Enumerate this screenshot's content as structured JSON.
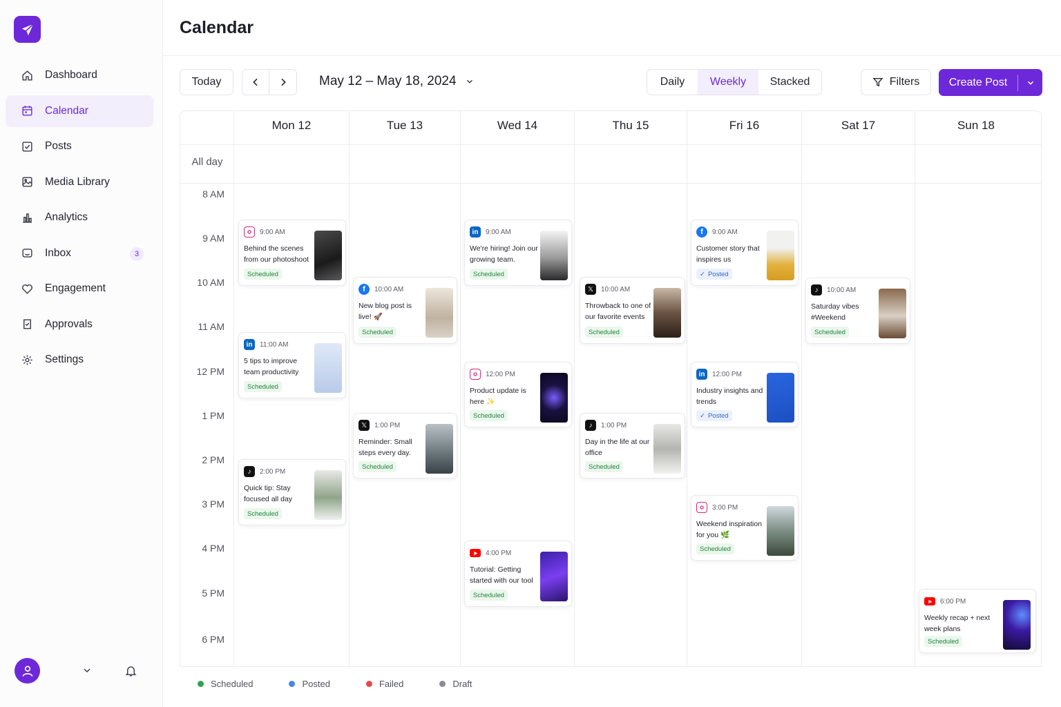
{
  "app": {
    "title": "Calendar"
  },
  "colors": {
    "accent": "#6d28d9",
    "scheduled": "#2da44e",
    "posted": "#4a86e8",
    "failed": "#e5484d",
    "draft": "#8a8a94"
  },
  "sidebar": {
    "logo_icon": "paper-plane-icon",
    "items": [
      {
        "label": "Dashboard",
        "icon": "home-icon"
      },
      {
        "label": "Calendar",
        "icon": "calendar-icon",
        "active": true
      },
      {
        "label": "Posts",
        "icon": "posts-icon"
      },
      {
        "label": "Media Library",
        "icon": "image-icon"
      },
      {
        "label": "Analytics",
        "icon": "bar-chart-icon"
      },
      {
        "label": "Inbox",
        "icon": "inbox-icon",
        "badge": "3"
      },
      {
        "label": "Engagement",
        "icon": "heart-icon"
      },
      {
        "label": "Approvals",
        "icon": "approval-icon"
      },
      {
        "label": "Settings",
        "icon": "gear-icon"
      }
    ]
  },
  "toolbar": {
    "today": "Today",
    "date_range": "May 12 – May 18, 2024",
    "views": [
      "Daily",
      "Weekly",
      "Stacked"
    ],
    "active_view": "Weekly",
    "filters": "Filters",
    "create": "Create Post"
  },
  "calendar": {
    "days": [
      "Mon 12",
      "Tue 13",
      "Wed 14",
      "Thu 15",
      "Fri 16",
      "Sat 17",
      "Sun 18"
    ],
    "all_day": "All day",
    "times": [
      "8 AM",
      "9 AM",
      "10 AM",
      "11 AM",
      "12 PM",
      "1 PM",
      "2 PM",
      "3 PM",
      "4 PM",
      "5 PM",
      "6 PM"
    ]
  },
  "events": [
    {
      "day": "Mon 12",
      "network": "instagram",
      "time": "9:00 AM",
      "text": "Behind the scenes from our photoshoot",
      "status": "Scheduled"
    },
    {
      "day": "Mon 12",
      "network": "linkedin",
      "time": "11:00 AM",
      "text": "5 tips to improve team productivity",
      "status": "Scheduled"
    },
    {
      "day": "Mon 12",
      "network": "tiktok",
      "time": "2:00 PM",
      "text": "Quick tip: Stay focused all day",
      "status": "Scheduled"
    },
    {
      "day": "Tue 13",
      "network": "facebook",
      "time": "10:00 AM",
      "text": "New blog post is live! 🚀",
      "status": "Scheduled"
    },
    {
      "day": "Tue 13",
      "network": "x",
      "time": "1:00 PM",
      "text": "Reminder: Small steps every day.",
      "status": "Scheduled"
    },
    {
      "day": "Wed 14",
      "network": "linkedin",
      "time": "9:00 AM",
      "text": "We're hiring! Join our growing team.",
      "status": "Scheduled"
    },
    {
      "day": "Wed 14",
      "network": "instagram",
      "time": "12:00 PM",
      "text": "Product update is here ✨",
      "status": "Scheduled"
    },
    {
      "day": "Wed 14",
      "network": "youtube",
      "time": "4:00 PM",
      "text": "Tutorial: Getting started with our tool",
      "status": "Scheduled"
    },
    {
      "day": "Thu 15",
      "network": "x",
      "time": "10:00 AM",
      "text": "Throwback to one of our favorite events",
      "status": "Scheduled"
    },
    {
      "day": "Thu 15",
      "network": "tiktok",
      "time": "1:00 PM",
      "text": "Day in the life at our office",
      "status": "Scheduled"
    },
    {
      "day": "Fri 16",
      "network": "facebook",
      "time": "9:00 AM",
      "text": "Customer story that inspires us",
      "status": "Posted"
    },
    {
      "day": "Fri 16",
      "network": "linkedin",
      "time": "12:00 PM",
      "text": "Industry insights and trends",
      "status": "Posted"
    },
    {
      "day": "Fri 16",
      "network": "instagram",
      "time": "3:00 PM",
      "text": "Weekend inspiration for you 🌿",
      "status": "Scheduled"
    },
    {
      "day": "Sat 17",
      "network": "tiktok",
      "time": "10:00 AM",
      "text": "Saturday vibes #Weekend",
      "status": "Scheduled"
    },
    {
      "day": "Sun 18",
      "network": "youtube",
      "time": "6:00 PM",
      "text": "Weekly recap + next week plans",
      "status": "Scheduled"
    }
  ],
  "legend": [
    {
      "label": "Scheduled",
      "color": "#2da44e"
    },
    {
      "label": "Posted",
      "color": "#4a86e8"
    },
    {
      "label": "Failed",
      "color": "#e5484d"
    },
    {
      "label": "Draft",
      "color": "#8a8a94"
    }
  ]
}
